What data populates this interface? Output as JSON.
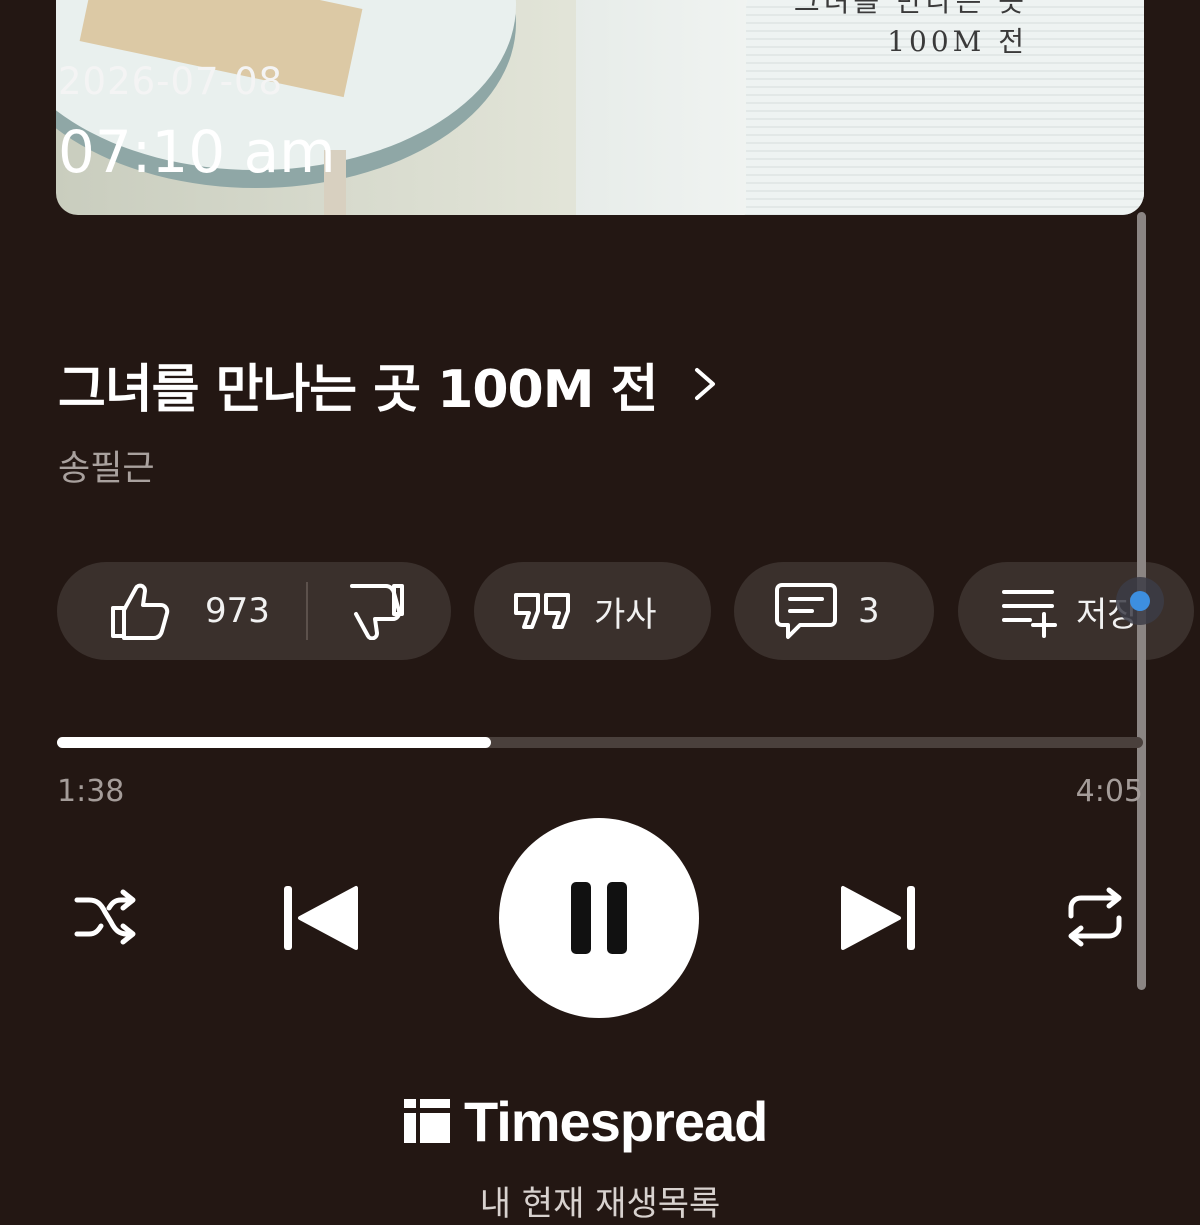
{
  "album_art": {
    "line1": "그녀를 만나는 곳",
    "line2": "100M 전"
  },
  "overlay": {
    "date": "2026-07-08",
    "time": "07:10 am"
  },
  "song": {
    "title": "그녀를 만나는 곳 100M 전",
    "artist": "송필근"
  },
  "actions": {
    "like_count": "973",
    "lyrics_label": "가사",
    "comment_count": "3",
    "save_label": "저장"
  },
  "progress": {
    "current": "1:38",
    "total": "4:05",
    "fraction": 0.4
  },
  "icons": {
    "like": "thumbs-up-icon",
    "dislike": "thumbs-down-icon",
    "lyrics": "quote-icon",
    "comment": "comment-icon",
    "save": "playlist-add-icon",
    "shuffle": "shuffle-icon",
    "prev": "skip-previous-icon",
    "pause": "pause-icon",
    "next": "skip-next-icon",
    "repeat": "repeat-icon",
    "brand": "timespread-logo-icon"
  },
  "watermark": {
    "brand": "Timespread"
  },
  "footer": {
    "queue_label": "내 현재 재생목록"
  },
  "colors": {
    "background": "#231713",
    "pill": "#3a302c",
    "accent_dot": "#3d8fe0"
  }
}
